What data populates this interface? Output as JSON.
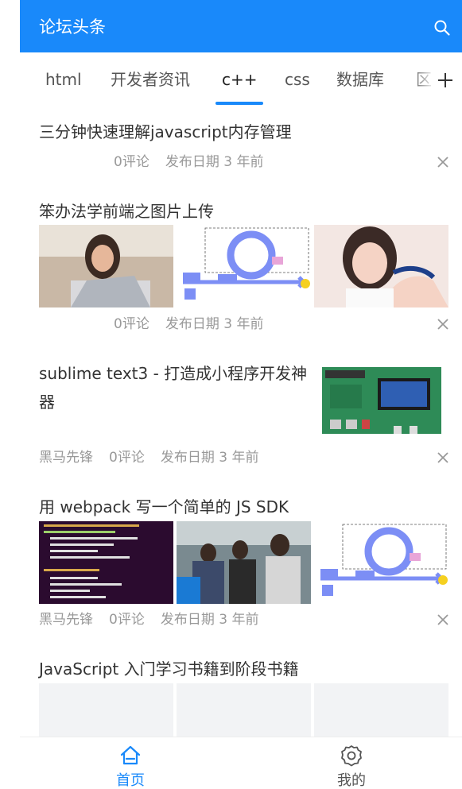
{
  "navbar": {
    "title": "论坛头条"
  },
  "tabs": [
    "html",
    "开发者资讯",
    "c++",
    "css",
    "数据库",
    "区"
  ],
  "articles": [
    {
      "title": "三分钟快速理解javascript内存管理",
      "author": "",
      "comments": "0评论",
      "date": "发布日期 3 年前"
    },
    {
      "title": "笨办法学前端之图片上传",
      "author": "",
      "comments": "0评论",
      "date": "发布日期 3 年前"
    },
    {
      "title": "sublime text3 - 打造成小程序开发神器",
      "author": "黑马先锋",
      "comments": "0评论",
      "date": "发布日期 3 年前"
    },
    {
      "title": "用 webpack 写一个简单的 JS SDK",
      "author": "黑马先锋",
      "comments": "0评论",
      "date": "发布日期 3 年前"
    },
    {
      "title": "JavaScript 入门学习书籍到阶段书籍"
    }
  ],
  "tabbar": {
    "home": "首页",
    "mine": "我的"
  },
  "colors": {
    "primary": "#1989fa",
    "text": "#333333",
    "muted": "#999999"
  },
  "icons": {
    "search": "search-icon",
    "close": "close-icon",
    "plus": "plus-icon",
    "home": "home-icon",
    "settings": "gear-icon"
  }
}
